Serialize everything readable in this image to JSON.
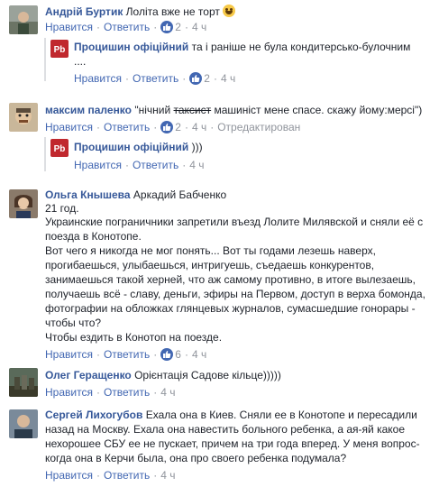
{
  "comments": [
    {
      "author": "Андрій Буртик",
      "text": "Лоліта вже не торт",
      "like": "Нравится",
      "reply": "Ответить",
      "likes": "2",
      "time": "4 ч",
      "reply_item": {
        "author": "Процишин офіційний",
        "text": "та і раніше не була кондитерсько-булочним",
        "text2": "....",
        "like": "Нравится",
        "reply": "Ответить",
        "likes": "2",
        "time": "4 ч"
      }
    },
    {
      "author": "максим паленко",
      "text_pre": "\"нічний ",
      "text_strike": "таксист",
      "text_post": " машиніст мене спасе. скажу йому:мерсі\")",
      "like": "Нравится",
      "reply": "Ответить",
      "likes": "2",
      "time": "4 ч",
      "edited": "Отредактирован",
      "reply_item": {
        "author": "Процишин офіційний",
        "text": ")))",
        "like": "Нравится",
        "reply": "Ответить",
        "time": "4 ч"
      }
    },
    {
      "author": "Ольга Кнышева",
      "mention": "Аркадий Бабченко",
      "age": "21 год.",
      "p1": "Украинские пограничники запретили въезд Лолите Милявской и сняли её с поезда в Конотопе.",
      "p2": "Вот чего я никогда не мог понять... Вот ты годами лезешь наверх, прогибаешься, улыбаешься, интригуешь, съедаешь конкурентов, занимаешься такой херней, что аж самому противно, в итоге вылезаешь, получаешь всё - славу, деньги, эфиры на Первом, доступ в верха бомонда, фотографии на обложках глянцевых журналов, сумасшедшие гонорары - чтобы что?",
      "p3": "Чтобы ездить в Конотоп на поезде.",
      "like": "Нравится",
      "reply": "Ответить",
      "likes": "6",
      "time": "4 ч"
    },
    {
      "author": "Олег Геращенко",
      "text": "Орієнтація Садове кільце)))))",
      "like": "Нравится",
      "reply": "Ответить",
      "time": "4 ч"
    },
    {
      "author": "Сергей Лихогубов",
      "text": "Ехала она в Киев. Сняли ее в Конотопе и пересадили назад на Москву. Ехала она навестить больного ребенка, а ая-яй какое нехорошее СБУ ее не пускает, причем на три года вперед. У меня вопрос- когда она в Керчи была, она про своего ребенка подумала?",
      "like": "Нравится",
      "reply": "Ответить",
      "time": "4 ч"
    }
  ],
  "colors": {
    "link": "#365899",
    "action": "#4267b2",
    "meta": "#90949c",
    "logo": "#c0282e"
  }
}
